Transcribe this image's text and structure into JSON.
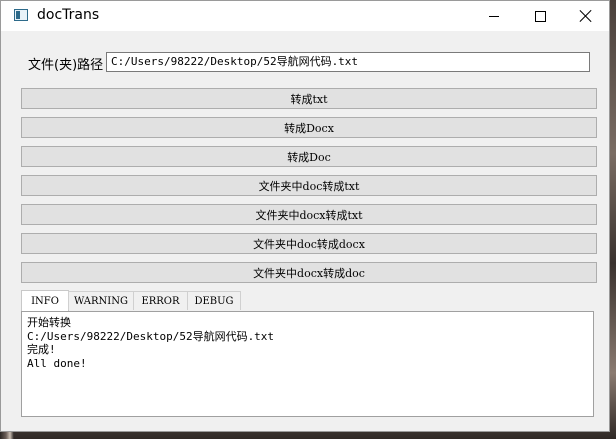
{
  "window": {
    "title": "docTrans",
    "icon": "app-window-icon",
    "controls": {
      "minimize": "minimize-icon",
      "maximize": "maximize-icon",
      "close": "close-icon"
    }
  },
  "path": {
    "label": "文件(夹)路径",
    "value": "C:/Users/98222/Desktop/52导航网代码.txt"
  },
  "actions": [
    {
      "label": "转成txt"
    },
    {
      "label": "转成Docx"
    },
    {
      "label": "转成Doc"
    },
    {
      "label": "文件夹中doc转成txt"
    },
    {
      "label": "文件夹中docx转成txt"
    },
    {
      "label": "文件夹中doc转成docx"
    },
    {
      "label": "文件夹中docx转成doc"
    }
  ],
  "log_tabs": [
    {
      "label": "INFO",
      "active": true
    },
    {
      "label": "WARNING",
      "active": false
    },
    {
      "label": "ERROR",
      "active": false
    },
    {
      "label": "DEBUG",
      "active": false
    }
  ],
  "log_lines": [
    "开始转换",
    "C:/Users/98222/Desktop/52导航网代码.txt",
    "完成!",
    "All done!"
  ]
}
